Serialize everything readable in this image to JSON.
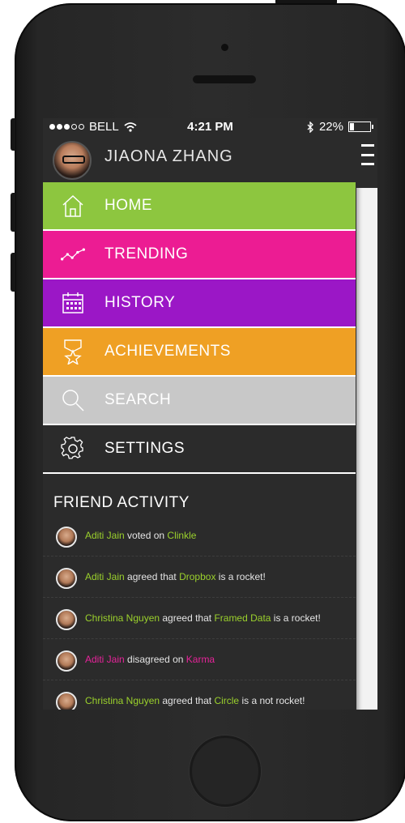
{
  "status_bar": {
    "carrier": "BELL",
    "time": "4:21 PM",
    "battery": "22%",
    "battery_level": 0.22,
    "signal_dots_filled": 3,
    "signal_dots_total": 5
  },
  "profile": {
    "name": "JIAONA ZHANG"
  },
  "menu": {
    "items": [
      {
        "label": "HOME",
        "icon": "home-icon",
        "color": "#8dc63f"
      },
      {
        "label": "TRENDING",
        "icon": "trending-icon",
        "color": "#ec1c93"
      },
      {
        "label": "HISTORY",
        "icon": "calendar-icon",
        "color": "#9b17c6"
      },
      {
        "label": "ACHIEVEMENTS",
        "icon": "trophy-icon",
        "color": "#efa024"
      },
      {
        "label": "SEARCH",
        "icon": "search-icon",
        "color": "#c8c8c8"
      },
      {
        "label": "SETTINGS",
        "icon": "gear-icon",
        "color": "#2b2b2b"
      }
    ]
  },
  "activity": {
    "title": "FRIEND ACTIVITY",
    "items": [
      {
        "name": "Aditi Jain",
        "action": " voted on ",
        "target": "Clinkle",
        "suffix": "",
        "accent": "#9bd12c"
      },
      {
        "name": "Aditi Jain",
        "action": " agreed that ",
        "target": "Dropbox",
        "suffix": " is a rocket!",
        "accent": "#9bd12c"
      },
      {
        "name": "Christina Nguyen",
        "action": " agreed that ",
        "target": "Framed Data",
        "suffix": " is a rocket!",
        "accent": "#9bd12c"
      },
      {
        "name": "Aditi Jain",
        "action": " disagreed on ",
        "target": "Karma",
        "suffix": "",
        "accent": "#e6239a"
      },
      {
        "name": "Christina Nguyen",
        "action": " agreed that ",
        "target": "Circle",
        "suffix": " is a not rocket!",
        "accent": "#9bd12c"
      }
    ]
  }
}
